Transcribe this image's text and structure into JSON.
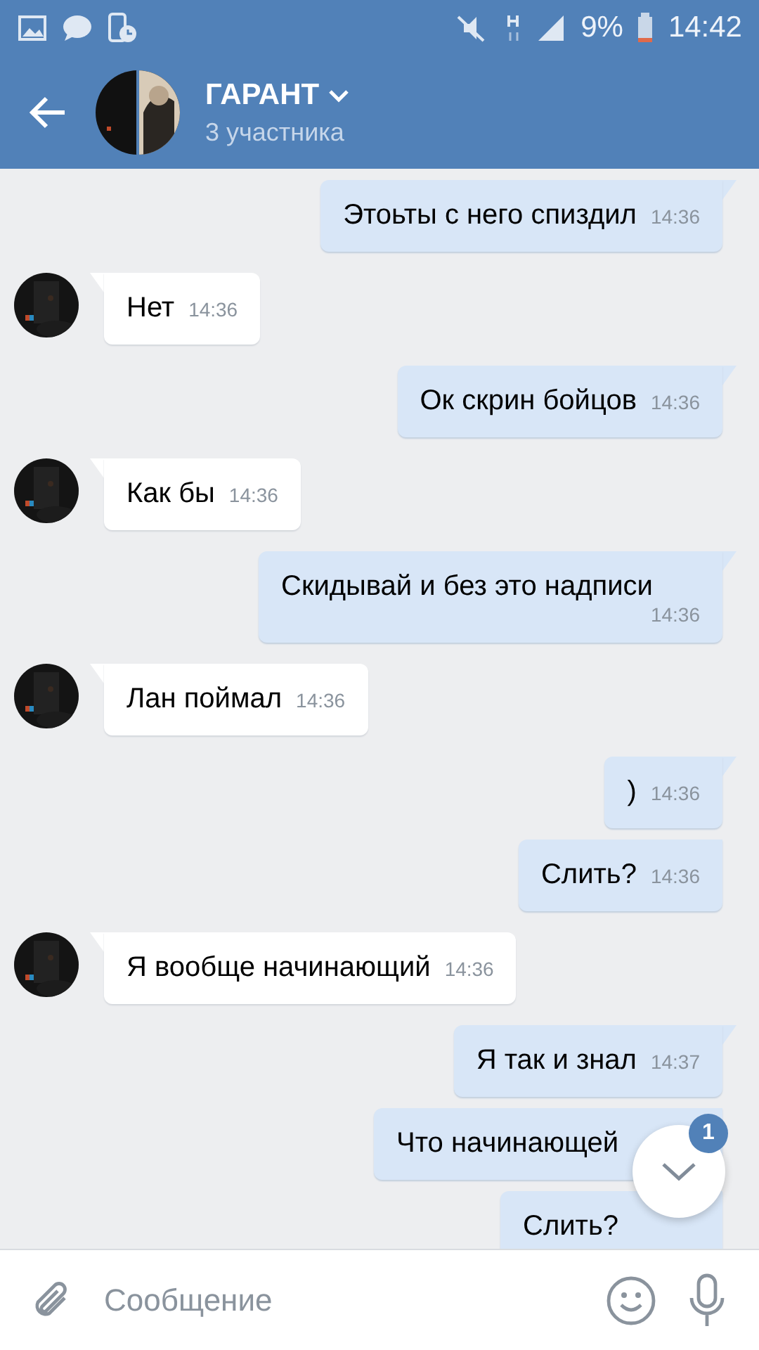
{
  "status_bar": {
    "battery": "9%",
    "time": "14:42"
  },
  "header": {
    "title": "ГАРАНТ",
    "subtitle": "3 участника"
  },
  "messages": [
    {
      "kind": "outgoing",
      "text": "Этоьты с него спиздил",
      "time": "14:36"
    },
    {
      "kind": "incoming",
      "text": "Нет",
      "time": "14:36"
    },
    {
      "kind": "outgoing",
      "text": "Ок скрин бойцов",
      "time": "14:36"
    },
    {
      "kind": "incoming",
      "text": "Как бы",
      "time": "14:36"
    },
    {
      "kind": "outgoing",
      "text": "Скидывай и без это надписи",
      "time": "14:36"
    },
    {
      "kind": "incoming",
      "text": "Лан поймал",
      "time": "14:36"
    },
    {
      "kind": "outgoing",
      "text": ")",
      "time": "14:36"
    },
    {
      "kind": "outgoing",
      "text": "Слить?",
      "time": "14:36"
    },
    {
      "kind": "incoming",
      "text": "Я вообще начинающий",
      "time": "14:36"
    },
    {
      "kind": "outgoing",
      "text": "Я так и знал",
      "time": "14:37"
    },
    {
      "kind": "outgoing",
      "text": "Что начинающей"
    },
    {
      "kind": "outgoing",
      "text": "Слить?"
    }
  ],
  "scroll_button": {
    "badge": "1"
  },
  "composer": {
    "placeholder": "Сообщение"
  }
}
